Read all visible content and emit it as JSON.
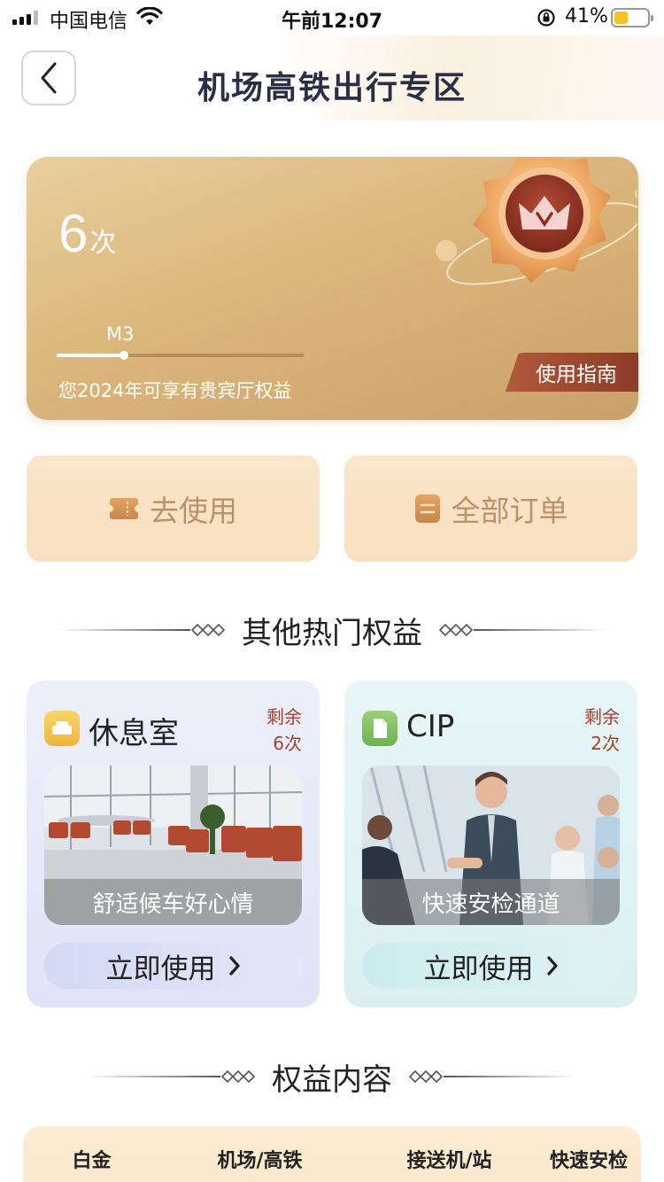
{
  "status_bar": {
    "carrier": "中国电信",
    "time": "午前12:07",
    "battery_percent": "41%",
    "battery_level": 0.41
  },
  "header": {
    "title": "机场高铁出行专区"
  },
  "member_card": {
    "count": "6",
    "count_unit": "次",
    "level": "M3",
    "progress": 0.27,
    "description": "您2024年可享有贵宾厅权益",
    "guide_label": "使用指南"
  },
  "actions": {
    "use_label": "去使用",
    "orders_label": "全部订单"
  },
  "hot_section": {
    "title": "其他热门权益"
  },
  "benefits": [
    {
      "name": "休息室",
      "remain_label": "剩余",
      "remain_count": "6次",
      "caption": "舒适候车好心情",
      "use_label": "立即使用"
    },
    {
      "name": "CIP",
      "remain_label": "剩余",
      "remain_count": "2次",
      "caption": "快速安检通道",
      "use_label": "立即使用"
    }
  ],
  "rights_section": {
    "title": "权益内容",
    "columns": [
      "白金",
      "机场/高铁",
      "接送机/站",
      "快速安检"
    ]
  },
  "colors": {
    "accent_gold": "#ddb97e",
    "remain_red": "#a5412b",
    "guide_red": "#8d3b27"
  }
}
